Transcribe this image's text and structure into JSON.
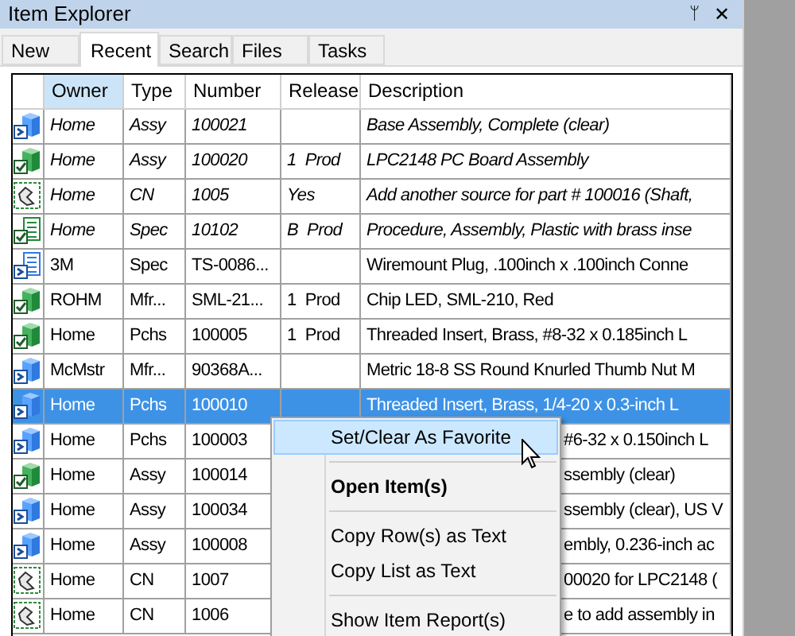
{
  "window": {
    "title": "Item Explorer",
    "pin": "ᛘ",
    "close": "✕"
  },
  "tabs": [
    {
      "label": "New",
      "selected": false
    },
    {
      "label": "Recent",
      "selected": true
    },
    {
      "label": "Search",
      "selected": false
    },
    {
      "label": "Files",
      "selected": false
    },
    {
      "label": "Tasks",
      "selected": false
    }
  ],
  "table": {
    "columns": [
      {
        "label": "Owner",
        "sorted": true
      },
      {
        "label": "Type",
        "sorted": false
      },
      {
        "label": "Number",
        "sorted": false
      },
      {
        "label": "Release",
        "sorted": false
      },
      {
        "label": "Description",
        "sorted": false
      }
    ],
    "rows": [
      {
        "kind": "box_blue",
        "italic": true,
        "selected": false,
        "covered": false,
        "owner": "Home",
        "type": "Assy",
        "number": "100021",
        "release": "",
        "description": "Base Assembly, Complete (clear)"
      },
      {
        "kind": "box_green",
        "italic": true,
        "selected": false,
        "covered": false,
        "owner": "Home",
        "type": "Assy",
        "number": "100020",
        "release": "1  Prod",
        "description": "LPC2148 PC Board Assembly"
      },
      {
        "kind": "cn",
        "italic": true,
        "selected": false,
        "covered": false,
        "owner": "Home",
        "type": "CN",
        "number": "1005",
        "release": "Yes",
        "description": "Add another source for part # 100016 (Shaft,"
      },
      {
        "kind": "doc_green",
        "italic": true,
        "selected": false,
        "covered": false,
        "owner": "Home",
        "type": "Spec",
        "number": "10102",
        "release": "B  Prod",
        "description": "Procedure, Assembly, Plastic with brass inse"
      },
      {
        "kind": "doc_blue",
        "italic": false,
        "selected": false,
        "covered": false,
        "owner": "3M",
        "type": "Spec",
        "number": "TS-0086...",
        "release": "",
        "description": "Wiremount Plug, .100inch x .100inch Conne"
      },
      {
        "kind": "box_green",
        "italic": false,
        "selected": false,
        "covered": false,
        "owner": "ROHM",
        "type": "Mfr...",
        "number": "SML-21...",
        "release": "1  Prod",
        "description": "Chip LED, SML-210, Red"
      },
      {
        "kind": "box_green",
        "italic": false,
        "selected": false,
        "covered": false,
        "owner": "Home",
        "type": "Pchs",
        "number": "100005",
        "release": "1  Prod",
        "description": "Threaded Insert, Brass, #8-32 x 0.185inch L"
      },
      {
        "kind": "box_blue",
        "italic": false,
        "selected": false,
        "covered": false,
        "owner": "McMstr",
        "type": "Mfr...",
        "number": "90368A...",
        "release": "",
        "description": "Metric 18-8 SS Round Knurled Thumb Nut M"
      },
      {
        "kind": "box_blue",
        "italic": false,
        "selected": true,
        "covered": false,
        "owner": "Home",
        "type": "Pchs",
        "number": "100010",
        "release": "",
        "description": "Threaded Insert, Brass, 1/4-20 x 0.3-inch L"
      },
      {
        "kind": "box_blue",
        "italic": false,
        "selected": false,
        "covered": true,
        "owner": "Home",
        "type": "Pchs",
        "number": "100003",
        "description": "#6-32 x 0.150inch L"
      },
      {
        "kind": "box_green",
        "italic": false,
        "selected": false,
        "covered": true,
        "owner": "Home",
        "type": "Assy",
        "number": "100014",
        "description": "ssembly (clear)"
      },
      {
        "kind": "box_blue",
        "italic": false,
        "selected": false,
        "covered": true,
        "owner": "Home",
        "type": "Assy",
        "number": "100034",
        "description": "ssembly (clear), US V"
      },
      {
        "kind": "box_blue",
        "italic": false,
        "selected": false,
        "covered": true,
        "owner": "Home",
        "type": "Assy",
        "number": "100008",
        "description": "embly, 0.236-inch ac"
      },
      {
        "kind": "cn",
        "italic": false,
        "selected": false,
        "covered": true,
        "owner": "Home",
        "type": "CN",
        "number": "1007",
        "description": "00020 for LPC2148 ("
      },
      {
        "kind": "cn",
        "italic": false,
        "selected": false,
        "covered": true,
        "owner": "Home",
        "type": "CN",
        "number": "1006",
        "description": "e to add assembly in"
      }
    ]
  },
  "context_menu": [
    {
      "kind": "item",
      "label": "Set/Clear As Favorite",
      "bold": false,
      "selected": true
    },
    {
      "kind": "separator"
    },
    {
      "kind": "item",
      "label": "Open Item(s)",
      "bold": true,
      "selected": false
    },
    {
      "kind": "separator"
    },
    {
      "kind": "item",
      "label": "Copy Row(s) as Text",
      "bold": false,
      "selected": false
    },
    {
      "kind": "item",
      "label": "Copy List as Text",
      "bold": false,
      "selected": false
    },
    {
      "kind": "separator"
    },
    {
      "kind": "item",
      "label": "Show Item Report(s)",
      "bold": false,
      "selected": false
    }
  ]
}
